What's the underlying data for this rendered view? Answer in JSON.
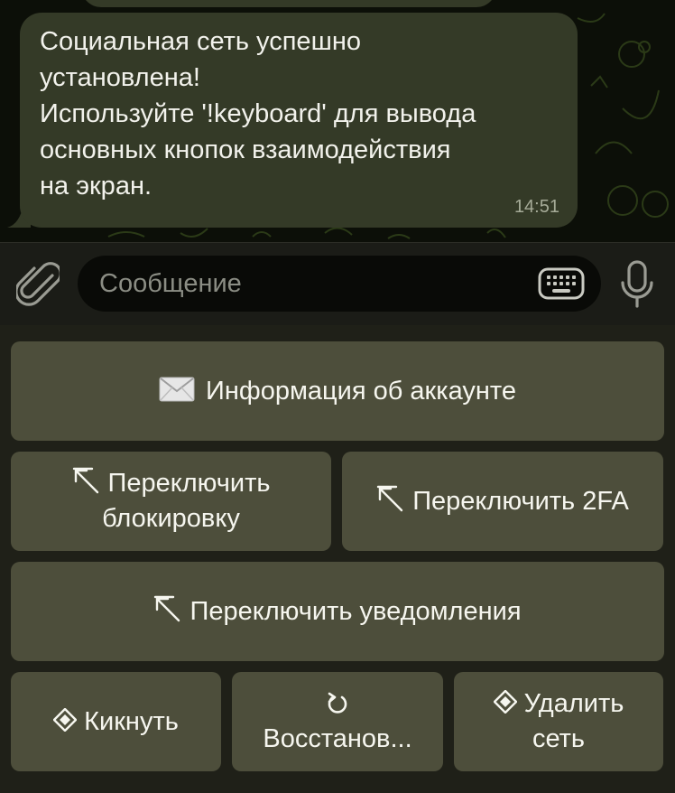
{
  "message": {
    "text": "Социальная сеть успешно\nустановлена!\nИспользуйте '!keyboard' для вывода\nосновных кнопок взаимодействия\nна экран.",
    "time": "14:51"
  },
  "input": {
    "placeholder": "Сообщение"
  },
  "keyboard": {
    "info_label": "Информация об аккаунте",
    "toggle_block_line1": "Переключить",
    "toggle_block_line2": "блокировку",
    "toggle_2fa_label": "Переключить 2FA",
    "toggle_notify_label": "Переключить уведомления",
    "kick_label": "Кикнуть",
    "restore_label": "Восстанов...",
    "delete_line1": "Удалить",
    "delete_line2": "сеть"
  },
  "icons": {
    "info": "envelope-icon",
    "toggle": "arrow-up-left-icon",
    "kick": "diamond-icon",
    "restore": "restore-icon",
    "delete": "diamond-icon",
    "attach": "paperclip-icon",
    "keyboard": "keyboard-icon",
    "mic": "microphone-icon"
  },
  "colors": {
    "bubble": "#343a27",
    "button": "#4d4e3b",
    "chat_background": "#0c0f08"
  }
}
